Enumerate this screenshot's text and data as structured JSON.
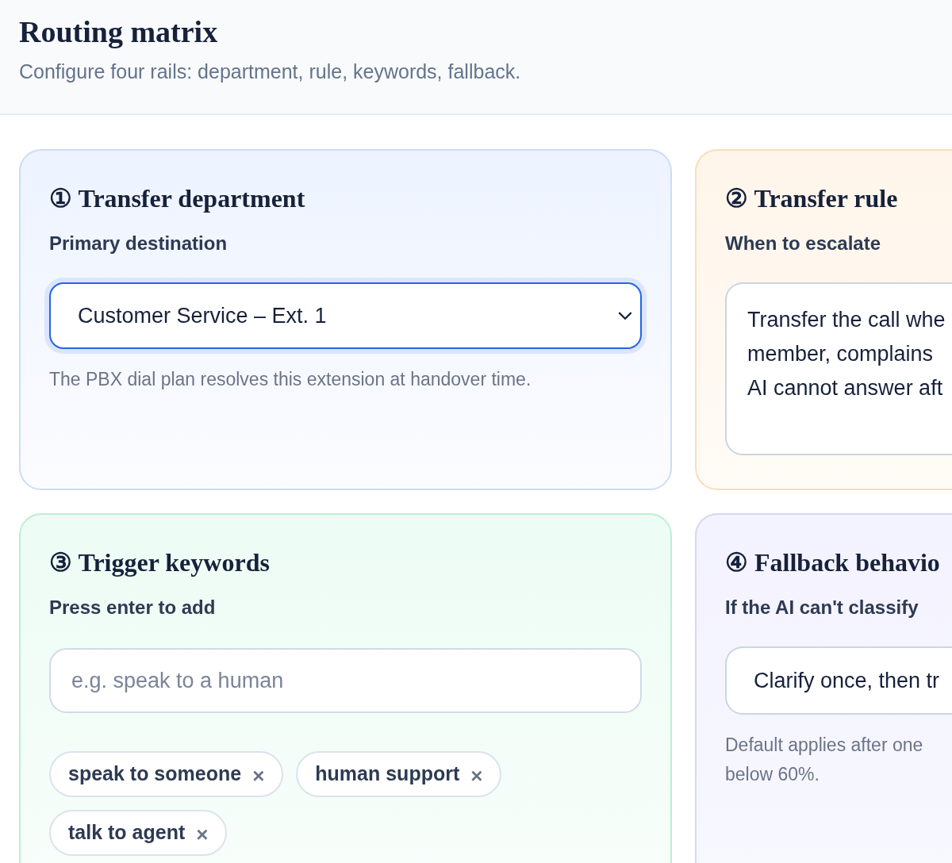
{
  "header": {
    "title": "Routing matrix",
    "subtitle": "Configure four rails: department, rule, keywords, fallback."
  },
  "cards": [
    {
      "kind": "select",
      "number": "①",
      "title": "Transfer department",
      "label": "Primary destination",
      "select": {
        "value": "Customer Service – Ext. 1",
        "focused": true
      },
      "help": "The PBX dial plan resolves this extension at handover time."
    },
    {
      "kind": "textarea",
      "number": "②",
      "title": "Transfer rule",
      "label": "When to escalate",
      "textarea": {
        "value": "Transfer the call whe\nmember, complains\nAI cannot answer aft"
      }
    },
    {
      "kind": "keywords",
      "number": "③",
      "title": "Trigger keywords",
      "label": "Press enter to add",
      "input": {
        "placeholder": "e.g. speak to a human"
      },
      "chips": [
        {
          "label": "speak to someone",
          "remove": "×"
        },
        {
          "label": "human support",
          "remove": "×"
        },
        {
          "label": "talk to agent",
          "remove": "×"
        }
      ]
    },
    {
      "kind": "field",
      "number": "④",
      "title": "Fallback behavio",
      "label": "If the AI can't classify",
      "field": {
        "value": "Clarify once, then tr"
      },
      "help": "Default applies after one\nbelow 60%."
    }
  ]
}
